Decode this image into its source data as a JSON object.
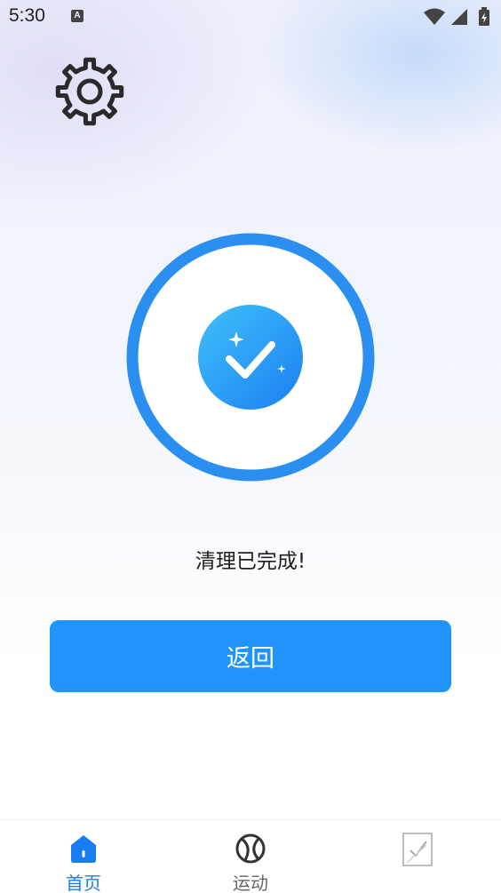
{
  "status_bar": {
    "time": "5:30",
    "notification_icon_glyph": "A"
  },
  "main": {
    "status_message": "清理已完成!",
    "return_button_label": "返回"
  },
  "bottom_nav": {
    "items": [
      {
        "label": "首页",
        "icon": "home-icon",
        "active": true
      },
      {
        "label": "运动",
        "icon": "ball-icon",
        "active": false
      },
      {
        "label": "",
        "icon": "note-icon",
        "active": false
      }
    ]
  },
  "colors": {
    "accent": "#2194fb",
    "ring": "#2b8ff2",
    "active_tab": "#1a7cf2",
    "inactive_tab": "#666666"
  }
}
